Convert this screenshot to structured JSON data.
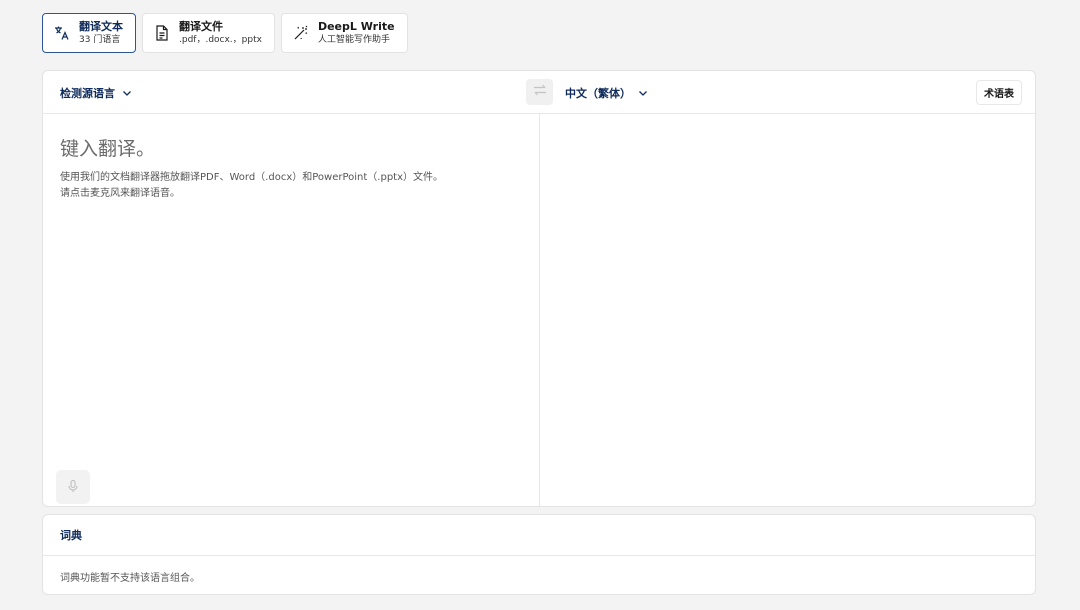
{
  "tabs": [
    {
      "title": "翻译文本",
      "subtitle": "33 门语言",
      "icon": "translate-icon",
      "active": true
    },
    {
      "title": "翻译文件",
      "subtitle": ".pdf，.docx.，pptx",
      "icon": "document-icon",
      "active": false
    },
    {
      "title": "DeepL Write",
      "subtitle": "人工智能写作助手",
      "icon": "magic-wand-icon",
      "active": false
    }
  ],
  "translator": {
    "source_language": "检测源语言",
    "target_language": "中文（繁体）",
    "glossary_label": "术语表",
    "placeholder": "键入翻译。",
    "hint_line1": "使用我们的文档翻译器拖放翻译PDF、Word（.docx）和PowerPoint（.pptx）文件。",
    "hint_line2": "请点击麦克风来翻译语音。"
  },
  "dictionary": {
    "title": "词典",
    "message": "词典功能暂不支持该语言组合。"
  },
  "colors": {
    "accent": "#0f2b5b",
    "active_border": "#2b5797",
    "background": "#f3f3f3"
  }
}
